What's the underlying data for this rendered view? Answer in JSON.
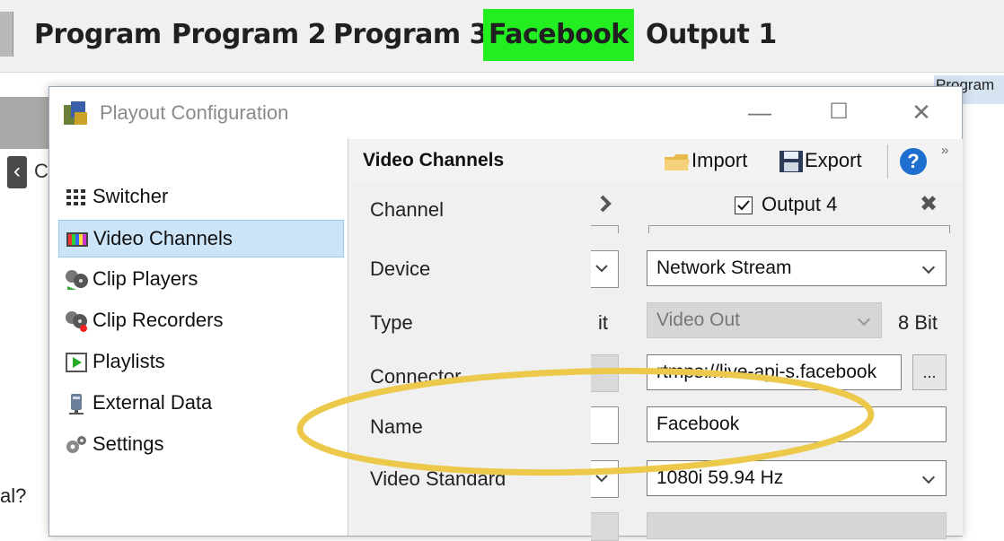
{
  "tabs": [
    "Program",
    "Program 2",
    "Program 3",
    "Facebook",
    "Output 1"
  ],
  "active_tab": "Facebook",
  "background": {
    "header_text": "Program",
    "fragment_c": "C",
    "fragment_question": "al?"
  },
  "dialog": {
    "title": "Playout Configuration",
    "minimize": "—",
    "maximize": "☐",
    "close": "✕"
  },
  "sidebar": {
    "items": [
      {
        "label": "Switcher",
        "icon": "switcher-icon"
      },
      {
        "label": "Video Channels",
        "icon": "video-channels-icon",
        "selected": true
      },
      {
        "label": "Clip Players",
        "icon": "clip-players-icon"
      },
      {
        "label": "Clip Recorders",
        "icon": "clip-recorders-icon"
      },
      {
        "label": "Playlists",
        "icon": "playlists-icon"
      },
      {
        "label": "External Data",
        "icon": "external-data-icon"
      },
      {
        "label": "Settings",
        "icon": "settings-icon"
      }
    ]
  },
  "pane": {
    "title": "Video Channels",
    "import_label": "Import",
    "export_label": "Export",
    "help": "?",
    "more": "»"
  },
  "form": {
    "labels": {
      "channel": "Channel",
      "device": "Device",
      "type": "Type",
      "connector": "Connector",
      "name": "Name",
      "video_standard": "Video Standard"
    },
    "output_checkbox_label": "Output 4",
    "output_checked": true,
    "remove_icon": "✖",
    "device_value": "Network Stream",
    "type_value": "Video Out",
    "type_bits": "8 Bit",
    "partial_bits": "it",
    "connector_value": "rtmps://live-api-s.facebook",
    "browse_label": "...",
    "name_value": "Facebook",
    "video_standard_value": "1080i 59.94 Hz"
  },
  "colors": {
    "active_tab": "#22ee22",
    "annotation_ellipse": "#ecc94b",
    "selection": "#cce4f7",
    "help_button": "#1e6fd0"
  }
}
